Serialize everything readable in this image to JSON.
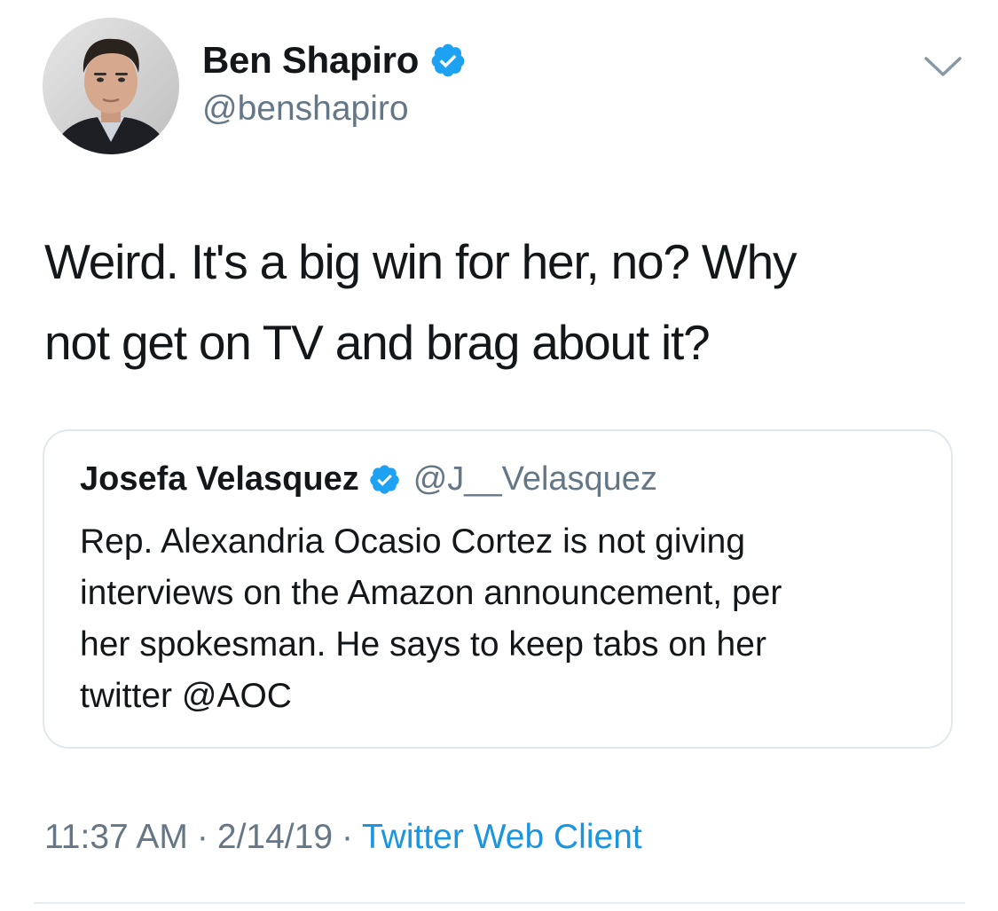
{
  "tweet": {
    "author": {
      "display_name": "Ben Shapiro",
      "handle": "@benshapiro",
      "verified": true,
      "avatar_icon": "profile-photo"
    },
    "menu_icon": "chevron-down-icon",
    "text_line1": "Weird. It's a big win for her, no? Why",
    "text_line2": "not get on TV and brag about it?",
    "quoted_tweet": {
      "author_name": "Josefa Velasquez",
      "author_handle": "@J__Velasquez",
      "verified": true,
      "text_line1": "Rep. Alexandria Ocasio Cortez is not giving",
      "text_line2": "interviews on the Amazon announcement, per",
      "text_line3": "her spokesman. He says to keep tabs on her",
      "text_line4": "twitter @AOC"
    },
    "time": "11:37 AM",
    "separator": "·",
    "date": "2/14/19",
    "source": "Twitter Web Client"
  },
  "colors": {
    "verified_blue": "#1da1f2",
    "link_blue": "#1b95e0",
    "secondary_text": "#657786",
    "primary_text": "#14171a",
    "card_border": "#e1e8ed"
  }
}
